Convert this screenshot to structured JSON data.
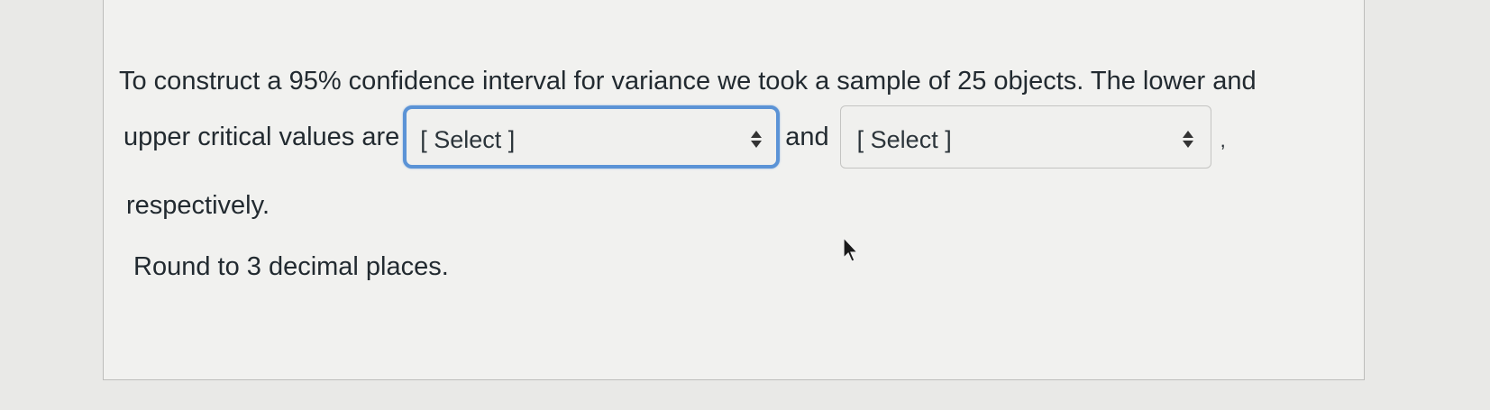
{
  "question": {
    "line1": "To construct a 95% confidence interval for variance we took a sample of 25 objects. The lower and",
    "line2_prefix": "upper critical values are",
    "connector": "and",
    "trailing_comma": ",",
    "respectively": "respectively.",
    "round_note": "Round to 3 decimal places."
  },
  "selects": [
    {
      "selected": "[ Select ]",
      "focused": true
    },
    {
      "selected": "[ Select ]",
      "focused": false
    }
  ],
  "colors": {
    "focus_ring": "#5b93d6",
    "text": "#222a30",
    "background": "#f1f1ef"
  },
  "icons": {
    "select_chevron": "chevron-up-down-icon",
    "cursor": "mouse-pointer-icon"
  }
}
